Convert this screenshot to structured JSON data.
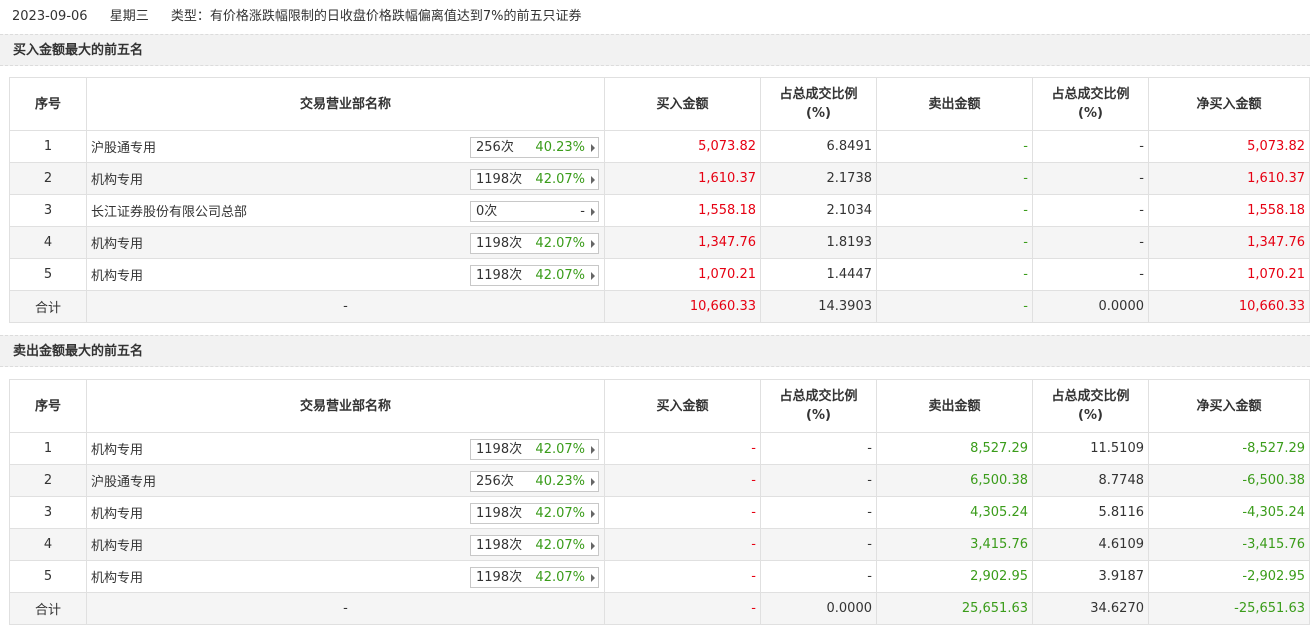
{
  "header": {
    "date": "2023-09-06",
    "weekday": "星期三",
    "type_text": "类型：有价格涨跌幅限制的日收盘价格跌幅偏离值达到7%的前五只证券"
  },
  "buy_section": {
    "title": "买入金额最大的前五名",
    "columns": [
      "序号",
      "交易营业部名称",
      "买入金额",
      "占总成交比例\n(%)",
      "卖出金额",
      "占总成交比例\n(%)",
      "净买入金额"
    ],
    "rows": [
      {
        "seq": "1",
        "name": "沪股通专用",
        "count": "256次",
        "rate": "40.23%",
        "buy": "5,073.82",
        "buy_ratio": "6.8491",
        "sell": "-",
        "sell_ratio": "-",
        "net": "5,073.82"
      },
      {
        "seq": "2",
        "name": "机构专用",
        "count": "1198次",
        "rate": "42.07%",
        "buy": "1,610.37",
        "buy_ratio": "2.1738",
        "sell": "-",
        "sell_ratio": "-",
        "net": "1,610.37"
      },
      {
        "seq": "3",
        "name": "长江证券股份有限公司总部",
        "count": "0次",
        "rate": "-",
        "buy": "1,558.18",
        "buy_ratio": "2.1034",
        "sell": "-",
        "sell_ratio": "-",
        "net": "1,558.18"
      },
      {
        "seq": "4",
        "name": "机构专用",
        "count": "1198次",
        "rate": "42.07%",
        "buy": "1,347.76",
        "buy_ratio": "1.8193",
        "sell": "-",
        "sell_ratio": "-",
        "net": "1,347.76"
      },
      {
        "seq": "5",
        "name": "机构专用",
        "count": "1198次",
        "rate": "42.07%",
        "buy": "1,070.21",
        "buy_ratio": "1.4447",
        "sell": "-",
        "sell_ratio": "-",
        "net": "1,070.21"
      }
    ],
    "total": {
      "label": "合计",
      "name": "-",
      "buy": "10,660.33",
      "buy_ratio": "14.3903",
      "sell": "-",
      "sell_ratio": "0.0000",
      "net": "10,660.33"
    }
  },
  "sell_section": {
    "title": "卖出金额最大的前五名",
    "columns": [
      "序号",
      "交易营业部名称",
      "买入金额",
      "占总成交比例\n(%)",
      "卖出金额",
      "占总成交比例\n(%)",
      "净买入金额"
    ],
    "rows": [
      {
        "seq": "1",
        "name": "机构专用",
        "count": "1198次",
        "rate": "42.07%",
        "buy": "-",
        "buy_ratio": "-",
        "sell": "8,527.29",
        "sell_ratio": "11.5109",
        "net": "-8,527.29"
      },
      {
        "seq": "2",
        "name": "沪股通专用",
        "count": "256次",
        "rate": "40.23%",
        "buy": "-",
        "buy_ratio": "-",
        "sell": "6,500.38",
        "sell_ratio": "8.7748",
        "net": "-6,500.38"
      },
      {
        "seq": "3",
        "name": "机构专用",
        "count": "1198次",
        "rate": "42.07%",
        "buy": "-",
        "buy_ratio": "-",
        "sell": "4,305.24",
        "sell_ratio": "5.8116",
        "net": "-4,305.24"
      },
      {
        "seq": "4",
        "name": "机构专用",
        "count": "1198次",
        "rate": "42.07%",
        "buy": "-",
        "buy_ratio": "-",
        "sell": "3,415.76",
        "sell_ratio": "4.6109",
        "net": "-3,415.76"
      },
      {
        "seq": "5",
        "name": "机构专用",
        "count": "1198次",
        "rate": "42.07%",
        "buy": "-",
        "buy_ratio": "-",
        "sell": "2,902.95",
        "sell_ratio": "3.9187",
        "net": "-2,902.95"
      }
    ],
    "total": {
      "label": "合计",
      "name": "-",
      "buy": "-",
      "buy_ratio": "0.0000",
      "sell": "25,651.63",
      "sell_ratio": "34.6270",
      "net": "-25,651.63"
    }
  },
  "colors": {
    "up_red": "#e60012",
    "down_green": "#3a9c1a",
    "header_gray": "#f2f2f2",
    "alt_row": "#f5f5f5"
  },
  "icons": {
    "pill_arrow": "caret-right-icon"
  }
}
